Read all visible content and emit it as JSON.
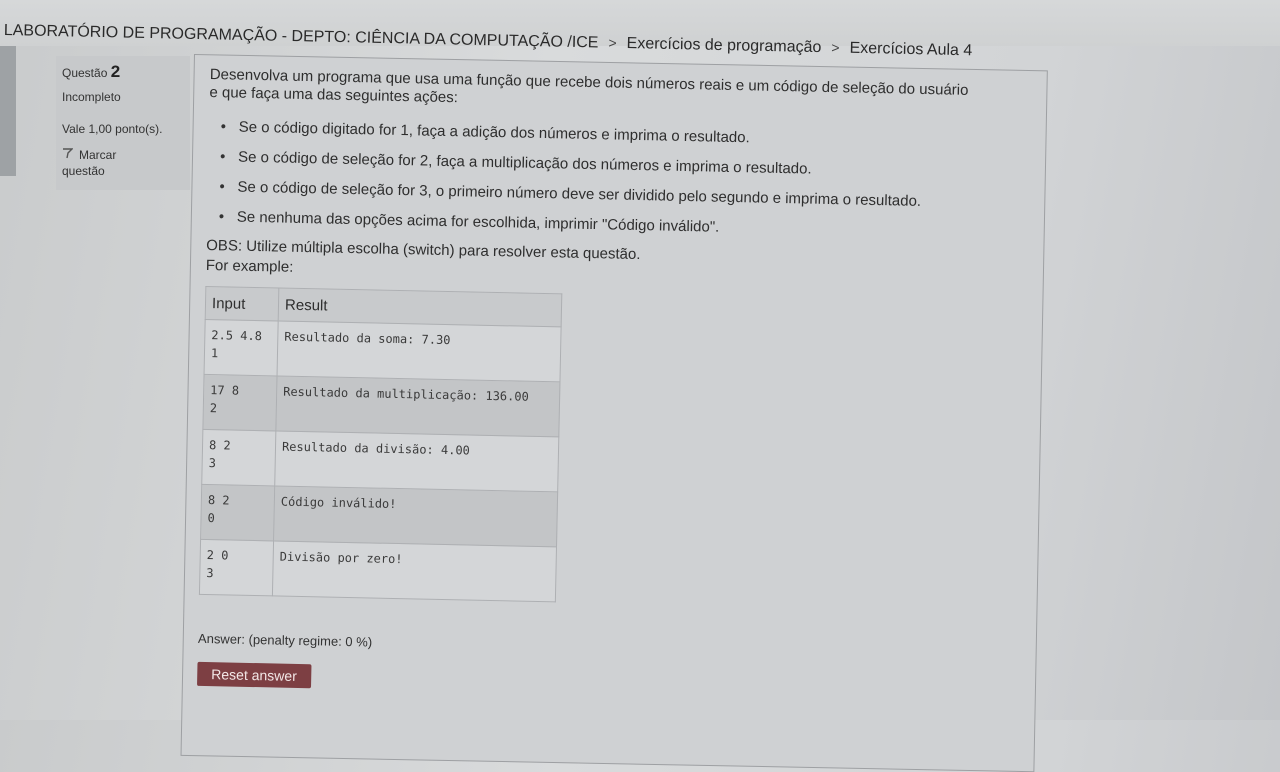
{
  "breadcrumb": {
    "course": "LABORATÓRIO DE PROGRAMAÇÃO - DEPTO: CIÊNCIA DA COMPUTAÇÃO /ICE",
    "section": "Exercícios de programação",
    "page": "Exercícios Aula 4",
    "separator": ">"
  },
  "question_info": {
    "label": "Questão",
    "number": "2",
    "status": "Incompleto",
    "points": "Vale 1,00 ponto(s).",
    "flag_line1": "Marcar",
    "flag_line2": "questão",
    "flag_icon": "flag-icon"
  },
  "question": {
    "intro": "Desenvolva um programa que usa uma função que recebe dois números reais e um código de seleção do usuário e que faça uma das seguintes ações:",
    "options": [
      "Se o código digitado for 1, faça a adição dos números e imprima o resultado.",
      "Se o código de seleção for 2, faça a multiplicação dos números e imprima o resultado.",
      "Se o código de seleção for 3, o primeiro número deve ser dividido pelo segundo e imprima o resultado.",
      "Se nenhuma das opções acima for escolhida, imprimir \"Código inválido\"."
    ],
    "obs": "OBS: Utilize múltipla escolha (switch) para resolver esta questão.",
    "for_example": "For example:"
  },
  "examples": {
    "headers": [
      "Input",
      "Result"
    ],
    "rows": [
      {
        "input": "2.5 4.8\n1",
        "result": "Resultado da soma: 7.30"
      },
      {
        "input": "17 8\n2",
        "result": "Resultado da multiplicação: 136.00"
      },
      {
        "input": "8 2\n3",
        "result": "Resultado da divisão: 4.00"
      },
      {
        "input": "8 2\n0",
        "result": "Código inválido!"
      },
      {
        "input": "2 0\n3",
        "result": "Divisão por zero!"
      }
    ]
  },
  "answer": {
    "label": "Answer:",
    "penalty": "(penalty regime: 0 %)",
    "reset_button": "Reset answer"
  },
  "colors": {
    "reset_button_bg": "#7d3f43",
    "page_bg": "#d2d4d6"
  }
}
